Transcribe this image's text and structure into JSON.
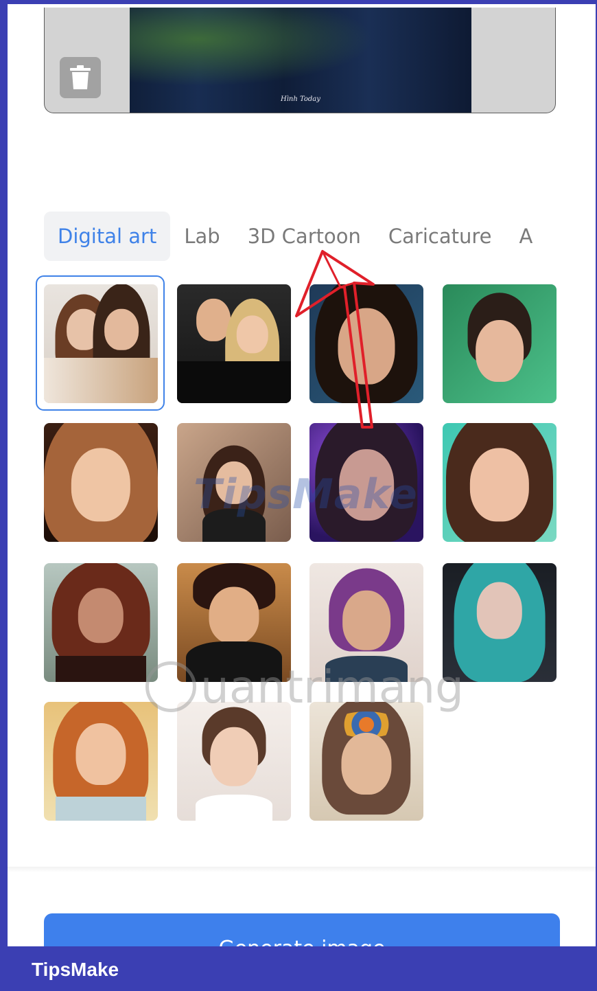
{
  "tabs": [
    {
      "label": "Digital art",
      "active": true
    },
    {
      "label": "Lab",
      "active": false
    },
    {
      "label": "3D Cartoon",
      "active": false
    },
    {
      "label": "Caricature",
      "active": false
    },
    {
      "label": "A",
      "active": false
    }
  ],
  "upload": {
    "delete_icon": "trash-icon",
    "photo_signature": "Hình Today"
  },
  "styles_grid": {
    "selected_index": 0,
    "thumbnails": [
      {
        "name": "style-1"
      },
      {
        "name": "style-2"
      },
      {
        "name": "style-3"
      },
      {
        "name": "style-4"
      },
      {
        "name": "style-5"
      },
      {
        "name": "style-6"
      },
      {
        "name": "style-7"
      },
      {
        "name": "style-8"
      },
      {
        "name": "style-9"
      },
      {
        "name": "style-10"
      },
      {
        "name": "style-11"
      },
      {
        "name": "style-12"
      },
      {
        "name": "style-13"
      },
      {
        "name": "style-14"
      },
      {
        "name": "style-15"
      }
    ]
  },
  "watermarks": {
    "tipsmake": "TipsMake",
    "quantrimang": "uantrimang"
  },
  "generate_button": {
    "label": "Generate image"
  },
  "footer": {
    "brand": "TipsMake"
  },
  "colors": {
    "accent": "#3f82e8",
    "frame": "#3b3fb3",
    "button": "#3e80ec",
    "arrow": "#e0202a"
  }
}
